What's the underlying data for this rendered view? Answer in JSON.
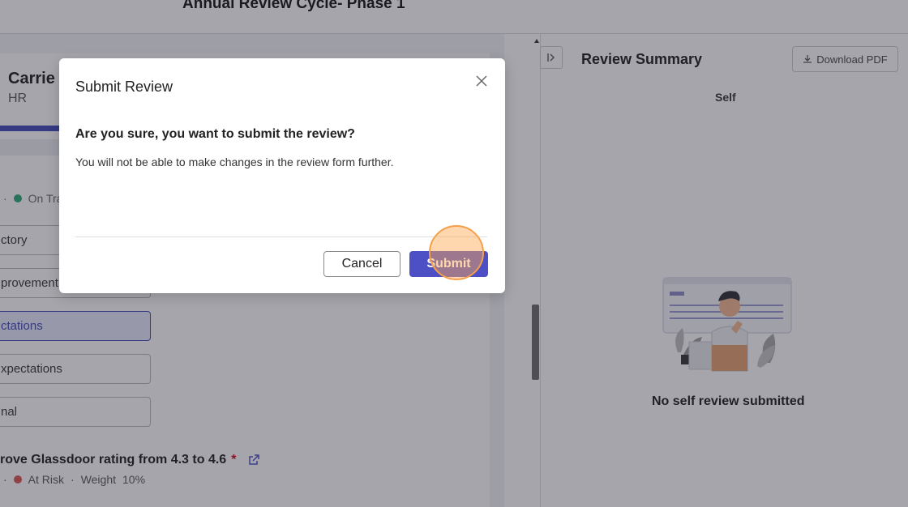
{
  "header": {
    "title": "Annual Review Cycle- Phase 1"
  },
  "employee": {
    "name": "Carrie",
    "department": "HR"
  },
  "status": {
    "label": "On Tra",
    "color": "#2aa876"
  },
  "rating_options": [
    {
      "label": "ctory",
      "selected": false
    },
    {
      "label": "provement",
      "selected": false
    },
    {
      "label": "ctations",
      "selected": true
    },
    {
      "label": "xpectations",
      "selected": false
    },
    {
      "label": "nal",
      "selected": false
    }
  ],
  "goal": {
    "title": "rove Glassdoor rating from 4.3 to 4.6",
    "required_mark": "*",
    "status": "At Risk",
    "status_color": "#d9534f",
    "weight_label": "Weight",
    "weight_value": "10%"
  },
  "summary": {
    "title": "Review Summary",
    "download_label": "Download PDF",
    "tab_self": "Self",
    "empty_text": "No self review submitted"
  },
  "modal": {
    "title": "Submit Review",
    "question": "Are you sure, you want to submit the review?",
    "message": "You will not be able to make changes in the review form further.",
    "cancel_label": "Cancel",
    "submit_label": "Submit"
  },
  "colors": {
    "accent": "#4c50c4",
    "selected_bg": "#e7e9fb"
  },
  "icons": [
    "close-icon",
    "external-link-icon",
    "download-icon",
    "collapse-panel-icon"
  ]
}
